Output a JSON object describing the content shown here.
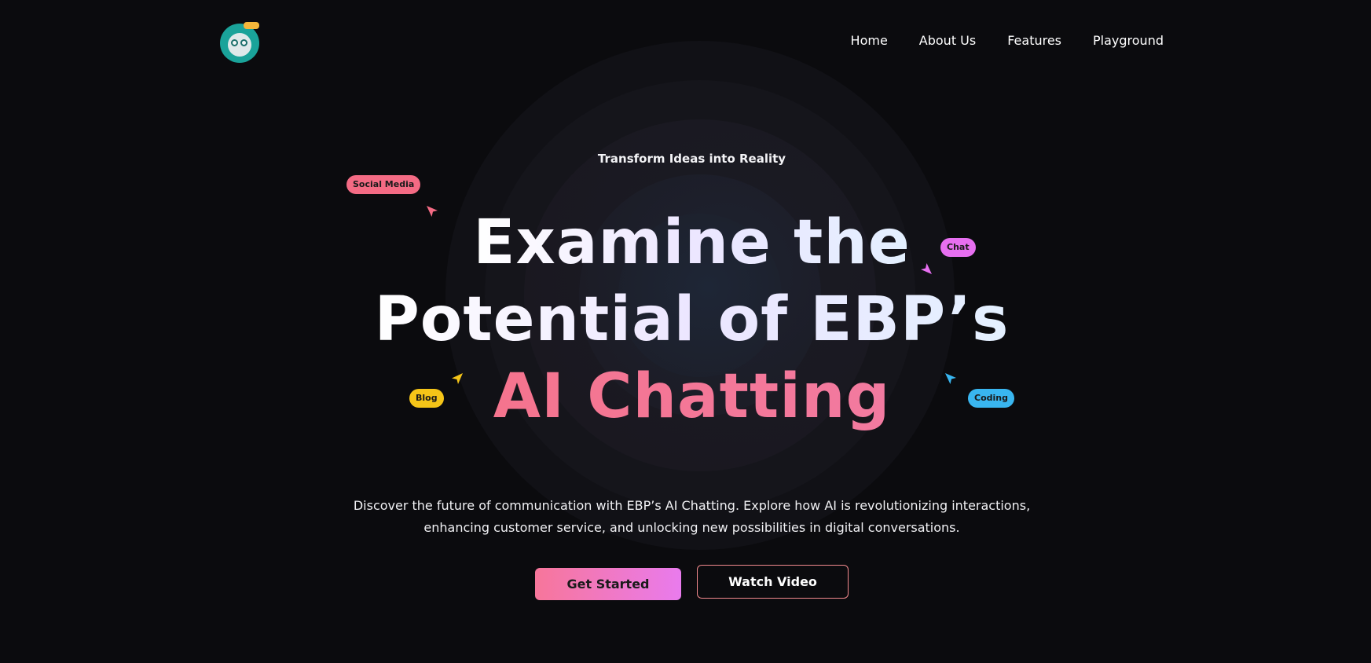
{
  "nav": {
    "items": [
      "Home",
      "About Us",
      "Features",
      "Playground"
    ]
  },
  "hero": {
    "eyebrow": "Transform Ideas into Reality",
    "headline_line1": "Examine the",
    "headline_line2": "Potential of EBP’s",
    "headline_line3": "AI Chatting",
    "description_line1": "Discover the future of communication with EBP’s AI Chatting. Explore how AI is revolutionizing interactions,",
    "description_line2": "enhancing customer service, and unlocking new possibilities in digital conversations.",
    "primary_button": "Get Started",
    "secondary_button": "Watch Video"
  },
  "tags": {
    "social": "Social Media",
    "chat": "Chat",
    "blog": "Blog",
    "coding": "Coding"
  },
  "colors": {
    "background": "#0b0b0e",
    "accent_pink": "#f5748e",
    "accent_violet": "#e97bed",
    "tag_yellow": "#f5c518",
    "tag_blue": "#39b6f0",
    "logo_teal": "#1aa39a"
  },
  "icons": {
    "logo": "robot-avatar-icon",
    "cursor": "pointer-arrow-icon"
  }
}
